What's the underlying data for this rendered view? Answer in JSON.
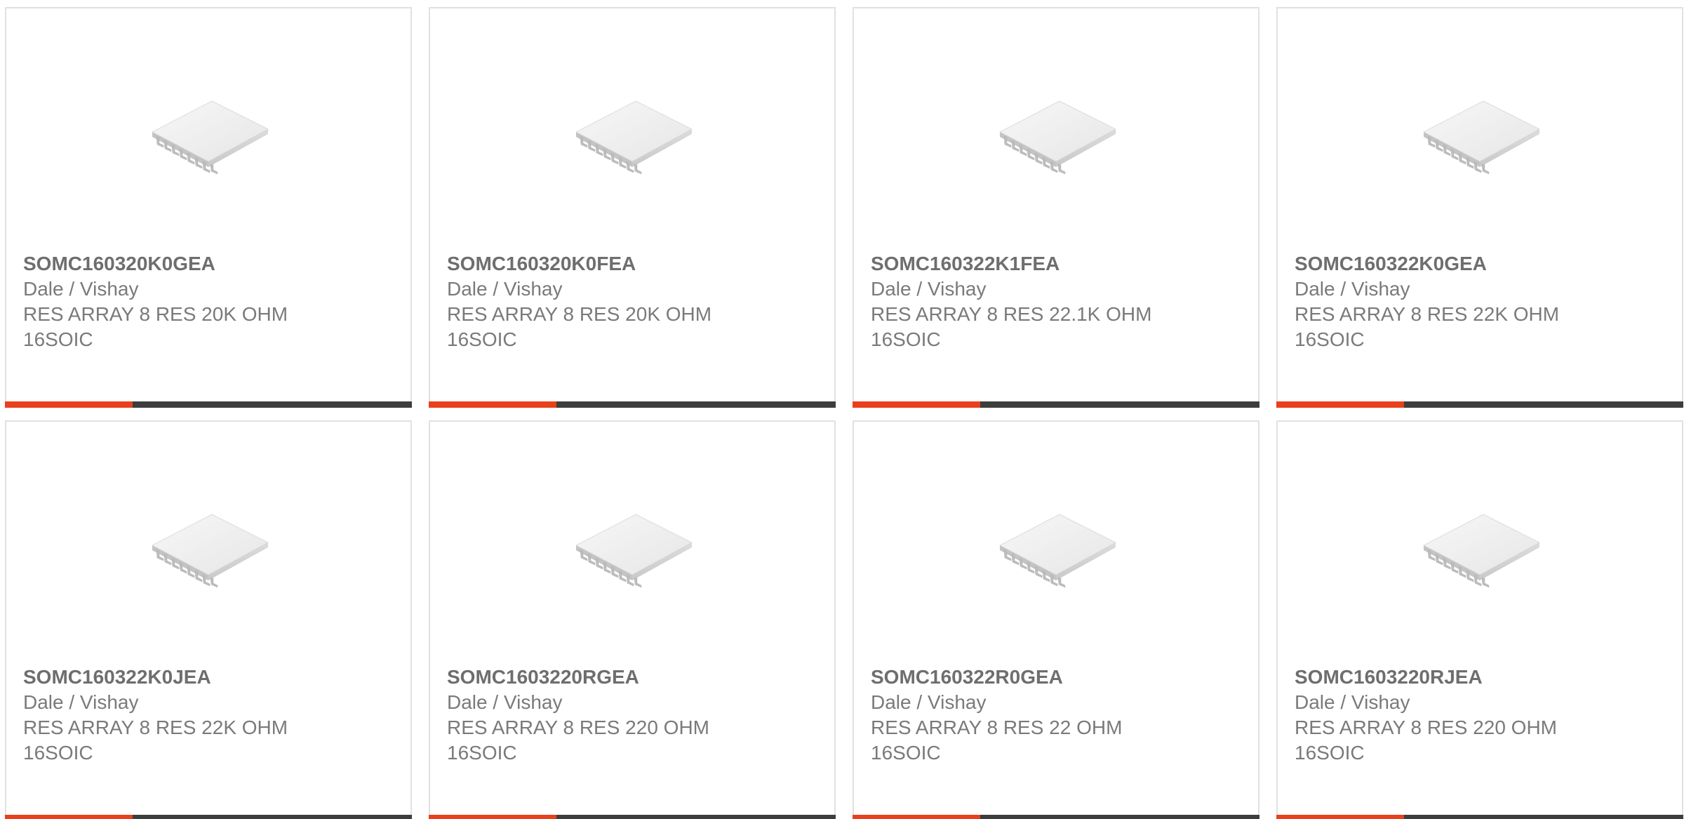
{
  "theme": {
    "accent_color": "#e8401c",
    "bar_color": "#3d3d3d",
    "border_color": "#e1e1e1",
    "text_color": "#7a7a7a"
  },
  "products": [
    {
      "part_number": "SOMC160320K0GEA",
      "manufacturer": "Dale / Vishay",
      "description_line1": "RES ARRAY 8 RES 20K OHM",
      "description_line2": "16SOIC",
      "image_icon": "soic-16-chip-icon"
    },
    {
      "part_number": "SOMC160320K0FEA",
      "manufacturer": "Dale / Vishay",
      "description_line1": "RES ARRAY 8 RES 20K OHM",
      "description_line2": "16SOIC",
      "image_icon": "soic-16-chip-icon"
    },
    {
      "part_number": "SOMC160322K1FEA",
      "manufacturer": "Dale / Vishay",
      "description_line1": "RES ARRAY 8 RES 22.1K OHM",
      "description_line2": "16SOIC",
      "image_icon": "soic-16-chip-icon"
    },
    {
      "part_number": "SOMC160322K0GEA",
      "manufacturer": "Dale / Vishay",
      "description_line1": "RES ARRAY 8 RES 22K OHM",
      "description_line2": "16SOIC",
      "image_icon": "soic-16-chip-icon"
    },
    {
      "part_number": "SOMC160322K0JEA",
      "manufacturer": "Dale / Vishay",
      "description_line1": "RES ARRAY 8 RES 22K OHM",
      "description_line2": "16SOIC",
      "image_icon": "soic-16-chip-icon"
    },
    {
      "part_number": "SOMC1603220RGEA",
      "manufacturer": "Dale / Vishay",
      "description_line1": "RES ARRAY 8 RES 220 OHM",
      "description_line2": "16SOIC",
      "image_icon": "soic-16-chip-icon"
    },
    {
      "part_number": "SOMC160322R0GEA",
      "manufacturer": "Dale / Vishay",
      "description_line1": "RES ARRAY 8 RES 22 OHM",
      "description_line2": "16SOIC",
      "image_icon": "soic-16-chip-icon"
    },
    {
      "part_number": "SOMC1603220RJEA",
      "manufacturer": "Dale / Vishay",
      "description_line1": "RES ARRAY 8 RES 220 OHM",
      "description_line2": "16SOIC",
      "image_icon": "soic-16-chip-icon"
    }
  ]
}
